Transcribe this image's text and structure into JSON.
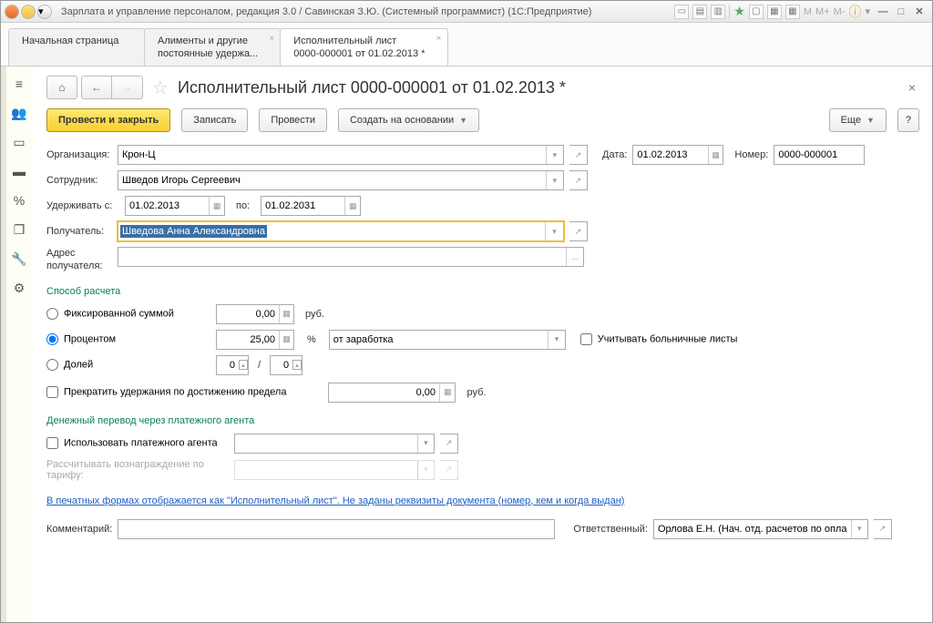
{
  "window": {
    "title": "Зарплата и управление персоналом, редакция 3.0 / Савинская З.Ю. (Системный программист)  (1С:Предприятие)"
  },
  "tabs": {
    "t1": "Начальная страница",
    "t2a": "Алименты и другие",
    "t2b": "постоянные удержа...",
    "t3a": "Исполнительный лист",
    "t3b": "0000-000001 от 01.02.2013 *"
  },
  "page_title": "Исполнительный лист 0000-000001 от 01.02.2013 *",
  "toolbar": {
    "post_close": "Провести и закрыть",
    "write": "Записать",
    "post": "Провести",
    "create_from": "Создать на основании",
    "more": "Еще",
    "help": "?"
  },
  "labels": {
    "organization": "Организация:",
    "date": "Дата:",
    "number": "Номер:",
    "employee": "Сотрудник:",
    "withhold_from": "Удерживать с:",
    "to": "по:",
    "recipient": "Получатель:",
    "recipient_addr": "Адрес получателя:",
    "calc_method": "Способ расчета",
    "fixed": "Фиксированной суммой",
    "percent": "Процентом",
    "share": "Долей",
    "rub": "руб.",
    "pct": "%",
    "from_salary": "от заработка",
    "include_sick": "Учитывать больничные листы",
    "stop_limit": "Прекратить удержания по достижению предела",
    "agent_section": "Денежный перевод через платежного агента",
    "use_agent": "Использовать платежного агента",
    "agent_fee": "Рассчитывать вознаграждение по тарифу:",
    "print_link": "В печатных формах отображается как \"Исполнительный лист\". Не заданы реквизиты документа (номер, кем и когда выдан)",
    "comment": "Комментарий:",
    "responsible": "Ответственный:",
    "slash": "/"
  },
  "values": {
    "organization": "Крон-Ц",
    "date": "01.02.2013",
    "number": "0000-000001",
    "employee": "Шведов Игорь Сергеевич",
    "date_from": "01.02.2013",
    "date_to": "01.02.2031",
    "recipient": "Шведова Анна Александровна",
    "fixed_amount": "0,00",
    "percent_value": "25,00",
    "share1": "0",
    "share2": "0",
    "limit_value": "0,00",
    "responsible": "Орлова Е.Н. (Нач. отд. расчетов по опла"
  },
  "glyphs": {
    "home": "⌂",
    "back": "←",
    "fwd": "→",
    "star": "☆",
    "dropdown": "▾",
    "open": "↗",
    "cal": "▦",
    "dots": "...",
    "calc": "▦",
    "M": "M",
    "Mplus": "M+",
    "Mminus": "M-",
    "i": "ⓘ"
  }
}
